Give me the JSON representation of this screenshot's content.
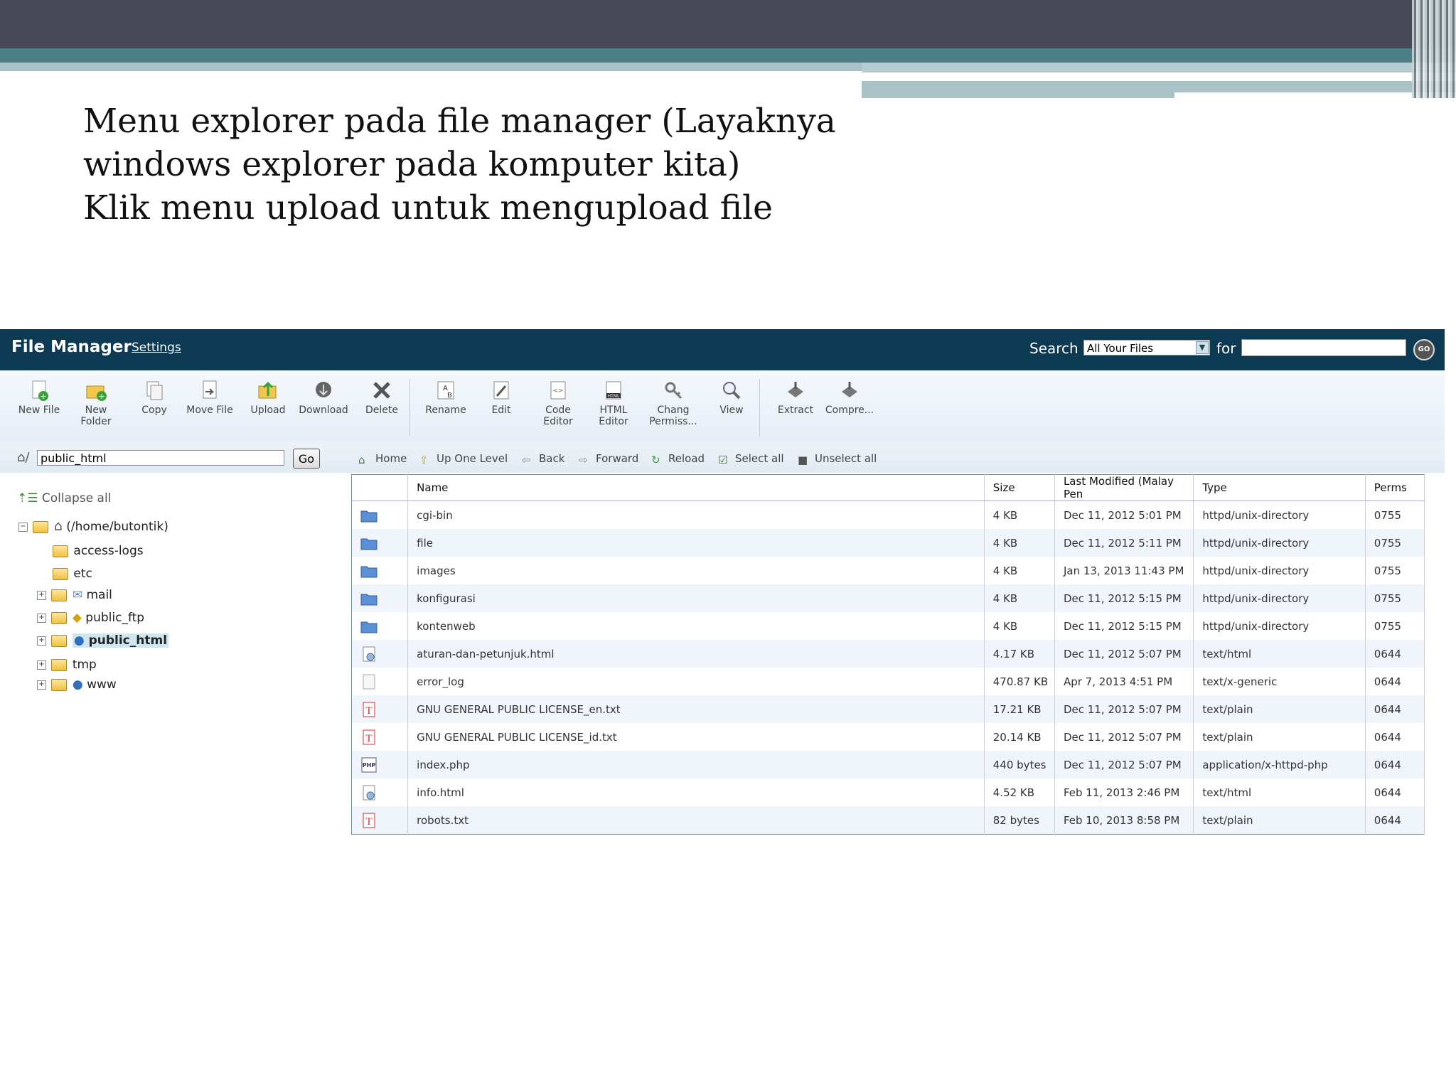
{
  "slide": {
    "lines": [
      "Menu explorer pada file manager (Layaknya",
      "windows explorer pada komputer kita)",
      "Klik menu upload untuk mengupload file"
    ]
  },
  "header": {
    "title": "File Manager",
    "settings": "Settings",
    "search_label": "Search",
    "search_scope": "All Your Files",
    "for_label": "for",
    "search_query": "",
    "go_label": "GO"
  },
  "toolbar": {
    "buttons": [
      {
        "label": "New File",
        "icon": "new-file-icon"
      },
      {
        "label": "New\nFolder",
        "icon": "new-folder-icon"
      },
      {
        "label": "Copy",
        "icon": "copy-icon"
      },
      {
        "label": "Move File",
        "icon": "move-file-icon"
      },
      {
        "label": "Upload",
        "icon": "upload-icon"
      },
      {
        "label": "Download",
        "icon": "download-icon"
      },
      {
        "label": "Delete",
        "icon": "delete-icon"
      },
      {
        "label": "Rename",
        "icon": "rename-icon"
      },
      {
        "label": "Edit",
        "icon": "edit-icon"
      },
      {
        "label": "Code\nEditor",
        "icon": "code-editor-icon"
      },
      {
        "label": "HTML\nEditor",
        "icon": "html-editor-icon"
      },
      {
        "label": "Chang\nPermiss...",
        "icon": "permissions-icon"
      },
      {
        "label": "View",
        "icon": "view-icon"
      },
      {
        "label": "Extract",
        "icon": "extract-icon"
      },
      {
        "label": "Compre...",
        "icon": "compress-icon"
      }
    ]
  },
  "left": {
    "path_value": "public_html",
    "go_label": "Go",
    "collapse_all": "Collapse all",
    "tree": {
      "root": "(/home/butontik)",
      "items": [
        "access-logs",
        "etc",
        "mail",
        "public_ftp",
        "public_html",
        "tmp",
        "www"
      ]
    }
  },
  "nav": {
    "home": "Home",
    "up": "Up One Level",
    "back": "Back",
    "forward": "Forward",
    "reload": "Reload",
    "select_all": "Select all",
    "unselect_all": "Unselect all"
  },
  "table": {
    "headers": {
      "name": "Name",
      "size": "Size",
      "modified": "Last Modified (Malay Pen",
      "type": "Type",
      "perms": "Perms"
    },
    "rows": [
      {
        "icon": "folder",
        "name": "cgi-bin",
        "size": "4 KB",
        "modified": "Dec 11, 2012 5:01 PM",
        "type": "httpd/unix-directory",
        "perms": "0755"
      },
      {
        "icon": "folder",
        "name": "file",
        "size": "4 KB",
        "modified": "Dec 11, 2012 5:11 PM",
        "type": "httpd/unix-directory",
        "perms": "0755"
      },
      {
        "icon": "folder",
        "name": "images",
        "size": "4 KB",
        "modified": "Jan 13, 2013 11:43 PM",
        "type": "httpd/unix-directory",
        "perms": "0755"
      },
      {
        "icon": "folder",
        "name": "konfigurasi",
        "size": "4 KB",
        "modified": "Dec 11, 2012 5:15 PM",
        "type": "httpd/unix-directory",
        "perms": "0755"
      },
      {
        "icon": "folder",
        "name": "kontenweb",
        "size": "4 KB",
        "modified": "Dec 11, 2012 5:15 PM",
        "type": "httpd/unix-directory",
        "perms": "0755"
      },
      {
        "icon": "html",
        "name": "aturan-dan-petunjuk.html",
        "size": "4.17 KB",
        "modified": "Dec 11, 2012 5:07 PM",
        "type": "text/html",
        "perms": "0644"
      },
      {
        "icon": "generic",
        "name": "error_log",
        "size": "470.87 KB",
        "modified": "Apr 7, 2013 4:51 PM",
        "type": "text/x-generic",
        "perms": "0644"
      },
      {
        "icon": "text",
        "name": "GNU GENERAL PUBLIC LICENSE_en.txt",
        "size": "17.21 KB",
        "modified": "Dec 11, 2012 5:07 PM",
        "type": "text/plain",
        "perms": "0644"
      },
      {
        "icon": "text",
        "name": "GNU GENERAL PUBLIC LICENSE_id.txt",
        "size": "20.14 KB",
        "modified": "Dec 11, 2012 5:07 PM",
        "type": "text/plain",
        "perms": "0644"
      },
      {
        "icon": "php",
        "name": "index.php",
        "size": "440 bytes",
        "modified": "Dec 11, 2012 5:07 PM",
        "type": "application/x-httpd-php",
        "perms": "0644"
      },
      {
        "icon": "html",
        "name": "info.html",
        "size": "4.52 KB",
        "modified": "Feb 11, 2013 2:46 PM",
        "type": "text/html",
        "perms": "0644"
      },
      {
        "icon": "text",
        "name": "robots.txt",
        "size": "82 bytes",
        "modified": "Feb 10, 2013 8:58 PM",
        "type": "text/plain",
        "perms": "0644"
      }
    ]
  },
  "colors": {
    "header_bg": "#0c3a52",
    "slide_dark": "#474757",
    "slide_teal": "#4d7f86",
    "row_alt": "#f0f4fb"
  }
}
